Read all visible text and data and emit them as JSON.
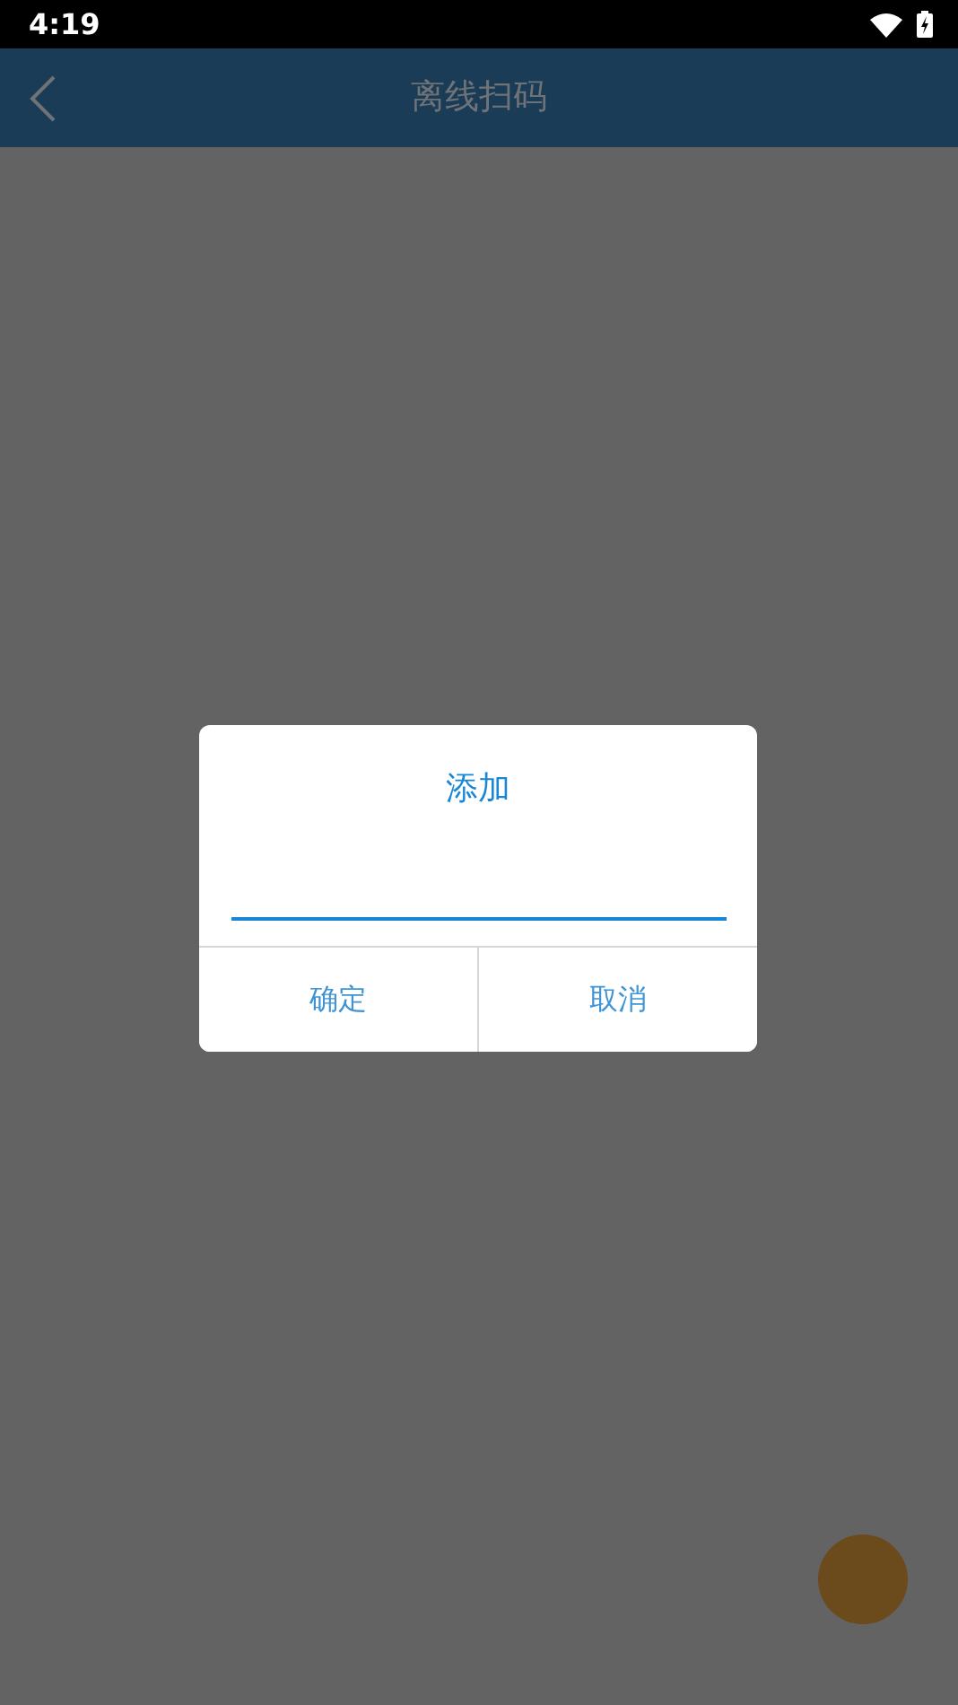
{
  "status_bar": {
    "time": "4:19"
  },
  "header": {
    "title": "离线扫码"
  },
  "dialog": {
    "title": "添加",
    "buttons": [
      {
        "label": "确定"
      },
      {
        "label": "取消"
      }
    ]
  }
}
